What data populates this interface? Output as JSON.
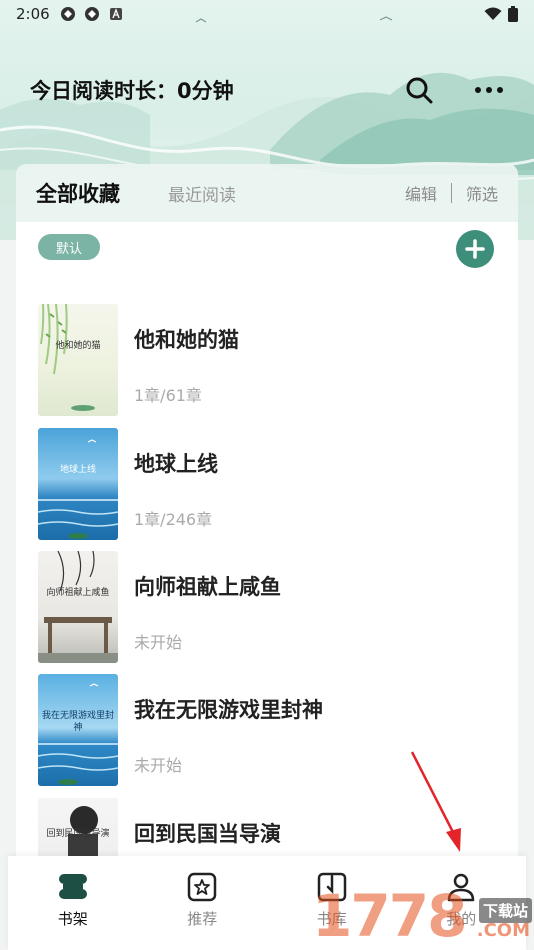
{
  "status_bar": {
    "time": "2:06"
  },
  "header": {
    "reading_time": "今日阅读时长：0分钟"
  },
  "tabs": {
    "active": "全部收藏",
    "recent": "最近阅读",
    "edit": "编辑",
    "filter": "筛选"
  },
  "group_tag": "默认",
  "books": [
    {
      "title": "他和她的猫",
      "progress": "1章/61章",
      "cover_text": "他和她的猫"
    },
    {
      "title": "地球上线",
      "progress": "1章/246章",
      "cover_text": "地球上线"
    },
    {
      "title": "向师祖献上咸鱼",
      "progress": "未开始",
      "cover_text": "向师祖献上咸鱼"
    },
    {
      "title": "我在无限游戏里封神",
      "progress": "未开始",
      "cover_text": "我在无限游戏里封神"
    },
    {
      "title": "回到民国当导演",
      "progress": "",
      "cover_text": "回到民国当导演"
    }
  ],
  "bottom_nav": {
    "shelf": "书架",
    "recommend": "推荐",
    "library": "书库",
    "mine": "我的"
  },
  "watermark": {
    "main": "1778",
    "sub": "下载站",
    "domain": ".COM"
  },
  "colors": {
    "accent": "#3d8f7b",
    "tag": "#7bb3a5"
  }
}
